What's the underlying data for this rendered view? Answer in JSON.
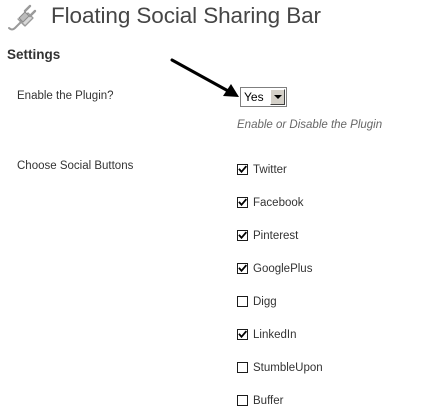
{
  "header": {
    "title": "Floating Social Sharing Bar",
    "icon": "plugin-icon"
  },
  "settings": {
    "section_title": "Settings",
    "enable_plugin": {
      "label": "Enable the Plugin?",
      "selected_value": "Yes",
      "description": "Enable or Disable the Plugin"
    },
    "social_buttons": {
      "label": "Choose Social Buttons",
      "items": [
        {
          "label": "Twitter",
          "checked": true
        },
        {
          "label": "Facebook",
          "checked": true
        },
        {
          "label": "Pinterest",
          "checked": true
        },
        {
          "label": "GooglePlus",
          "checked": true
        },
        {
          "label": "Digg",
          "checked": false
        },
        {
          "label": "LinkedIn",
          "checked": true
        },
        {
          "label": "StumbleUpon",
          "checked": false
        },
        {
          "label": "Buffer",
          "checked": false
        }
      ]
    }
  },
  "colors": {
    "title": "#464646",
    "text": "#333333",
    "description": "#666666",
    "background": "#ffffff"
  }
}
